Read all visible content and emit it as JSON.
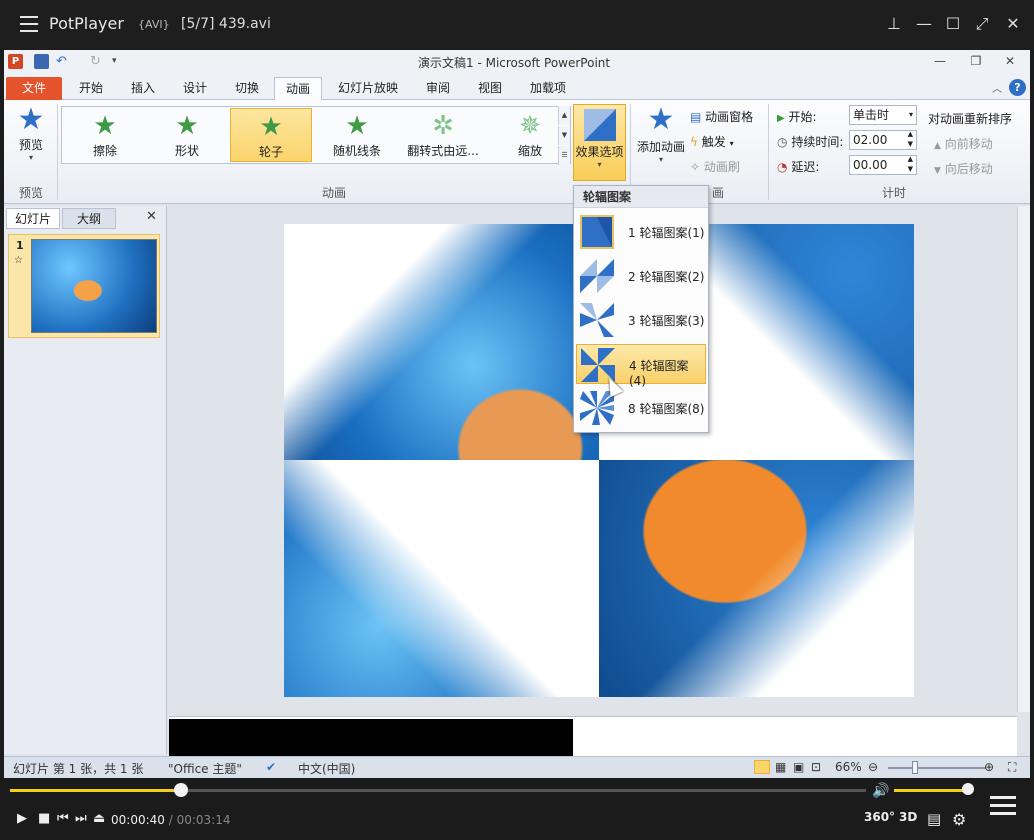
{
  "player": {
    "app_name": "PotPlayer",
    "format": "{AVI}",
    "file_title": "[5/7] 439.avi",
    "current_time": "00:00:40",
    "separator": "/",
    "total_time": "00:03:14",
    "progress": 0.2,
    "volume": 0.9,
    "badge_360": "360°",
    "badge_3d": "3D",
    "accent_color": "#f3d11a"
  },
  "ppt": {
    "doc_title": "演示文稿1  -  Microsoft PowerPoint",
    "tabs": [
      "文件",
      "开始",
      "插入",
      "设计",
      "切换",
      "动画",
      "幻灯片放映",
      "审阅",
      "视图",
      "加载项"
    ],
    "active_tab": "动画",
    "preview_group": {
      "button": "预览",
      "label": "预览"
    },
    "animation_group": {
      "label": "动画",
      "items": [
        "擦除",
        "形状",
        "轮子",
        "随机线条",
        "翻转式由远...",
        "缩放"
      ],
      "selected": "轮子"
    },
    "effect_options_label": "效果选项",
    "add_animation_label": "添加动画",
    "advanced": {
      "pane": "动画窗格",
      "trigger": "触发",
      "painter": "动画刷",
      "group_label_fragment": "画"
    },
    "timing": {
      "label": "计时",
      "start_label": "开始:",
      "start_value": "单击时",
      "duration_label": "持续时间:",
      "duration_value": "02.00",
      "delay_label": "延迟:",
      "delay_value": "00.00",
      "reorder_title": "对动画重新排序",
      "move_earlier": "向前移动",
      "move_later": "向后移动"
    },
    "pane_tabs": [
      "幻灯片",
      "大纲"
    ],
    "slide_number": "1",
    "dropdown": {
      "header": "轮辐图案",
      "items": [
        "1 轮辐图案(1)",
        "2 轮辐图案(2)",
        "3 轮辐图案(3)",
        "4 轮辐图案(4)",
        "8 轮辐图案(8)"
      ],
      "highlighted": "4 轮辐图案(4)"
    },
    "status": {
      "slide_info": "幻灯片 第 1 张，共 1 张",
      "theme": "\"Office 主题\"",
      "language": "中文(中国)",
      "zoom": "66%"
    }
  }
}
